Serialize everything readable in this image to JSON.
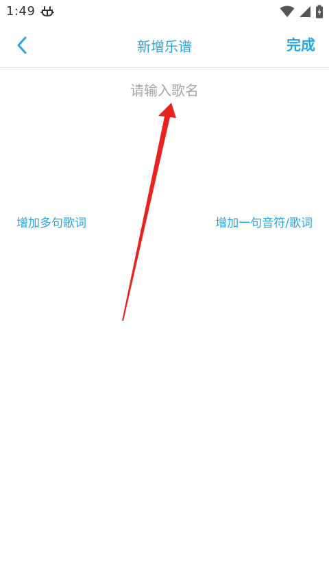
{
  "status_bar": {
    "time": "1:49",
    "icons": [
      "bug-icon",
      "wifi-icon",
      "signal-icon",
      "battery-icon"
    ]
  },
  "header": {
    "back_icon": "chevron-left-icon",
    "title": "新增乐谱",
    "done_label": "完成"
  },
  "song_name": {
    "value": "",
    "placeholder": "请输入歌名"
  },
  "actions": {
    "add_multiple_lyrics": "增加多句歌词",
    "add_one_note_lyric": "增加一句音符/歌词"
  },
  "colors": {
    "accent": "#27a6e5",
    "placeholder": "#a6a6a6",
    "annotation_arrow": "#e8231f"
  }
}
